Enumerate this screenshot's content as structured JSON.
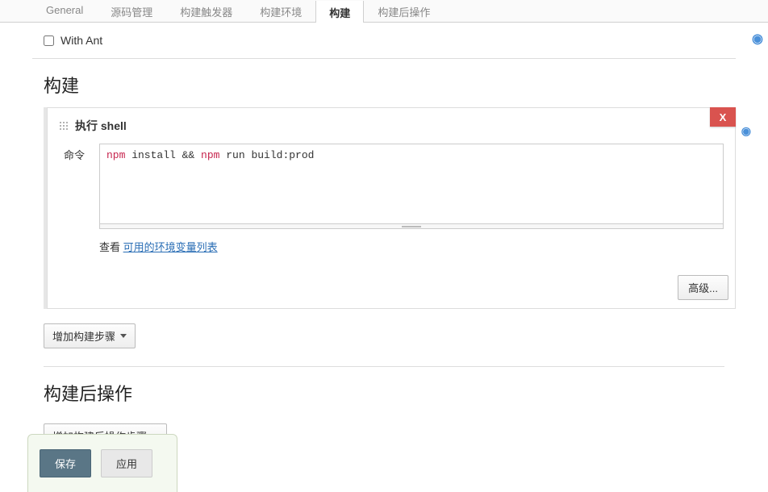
{
  "tabs": {
    "general": "General",
    "scm": "源码管理",
    "triggers": "构建触发器",
    "env": "构建环境",
    "build": "构建",
    "post_build": "构建后操作"
  },
  "with_ant_label": "With Ant",
  "sections": {
    "build_title": "构建",
    "post_build_title": "构建后操作"
  },
  "shell_step": {
    "title": "执行 shell",
    "delete_x": "X",
    "command_label": "命令",
    "command_kw1": "npm",
    "command_mid": " install && ",
    "command_kw2": "npm",
    "command_tail": " run build:prod",
    "env_prefix": "查看 ",
    "env_link": "可用的环境变量列表",
    "advanced_btn": "高级..."
  },
  "add_build_step_label": "增加构建步骤",
  "add_post_build_step_label": "增加构建后操作步骤",
  "buttons": {
    "save": "保存",
    "apply": "应用"
  },
  "help_glyph": "?"
}
